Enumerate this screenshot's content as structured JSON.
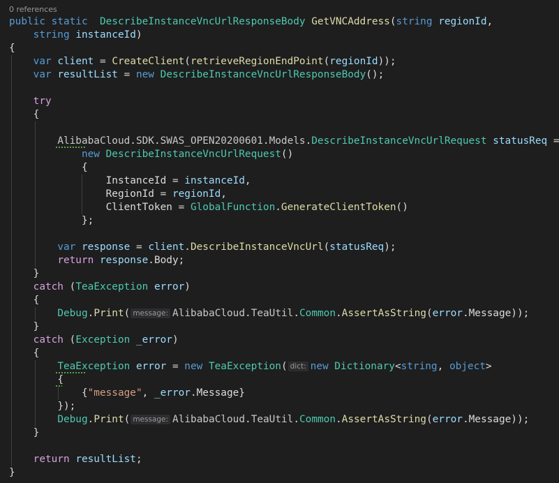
{
  "codelens": "0 references",
  "inlay_hints": {
    "message": "message:",
    "dict": "dict:"
  },
  "lines": [
    "public static  DescribeInstanceVncUrlResponseBody GetVNCAddress(string regionId,",
    "    string instanceId)",
    "{",
    "    var client = CreateClient(retrieveRegionEndPoint(regionId));",
    "    var resultList = new DescribeInstanceVncUrlResponseBody();",
    "",
    "    try",
    "    {",
    "",
    "        AlibabaCloud.SDK.SWAS_OPEN20200601.Models.DescribeInstanceVncUrlRequest statusReq =",
    "            new DescribeInstanceVncUrlRequest()",
    "            {",
    "                InstanceId = instanceId,",
    "                RegionId = regionId,",
    "                ClientToken = GlobalFunction.GenerateClientToken()",
    "            };",
    "",
    "        var response = client.DescribeInstanceVncUrl(statusReq);",
    "        return response.Body;",
    "    }",
    "    catch (TeaException error)",
    "    {",
    "        Debug.Print(message:AlibabaCloud.TeaUtil.Common.AssertAsString(error.Message));",
    "    }",
    "    catch (Exception _error)",
    "    {",
    "        TeaException error = new TeaException(dict:new Dictionary<string, object>",
    "        {",
    "            {\"message\", _error.Message}",
    "        });",
    "        Debug.Print(message:AlibabaCloud.TeaUtil.Common.AssertAsString(error.Message));",
    "    }",
    "",
    "    return resultList;",
    "}"
  ],
  "colors": {
    "background": "#1e1e1e",
    "keyword": "#569cd6",
    "control_keyword": "#d8a0df",
    "type": "#4ec9b0",
    "method": "#dcdcaa",
    "variable": "#9cdcfe",
    "string": "#d69d85",
    "plain": "#dcdcdc"
  }
}
